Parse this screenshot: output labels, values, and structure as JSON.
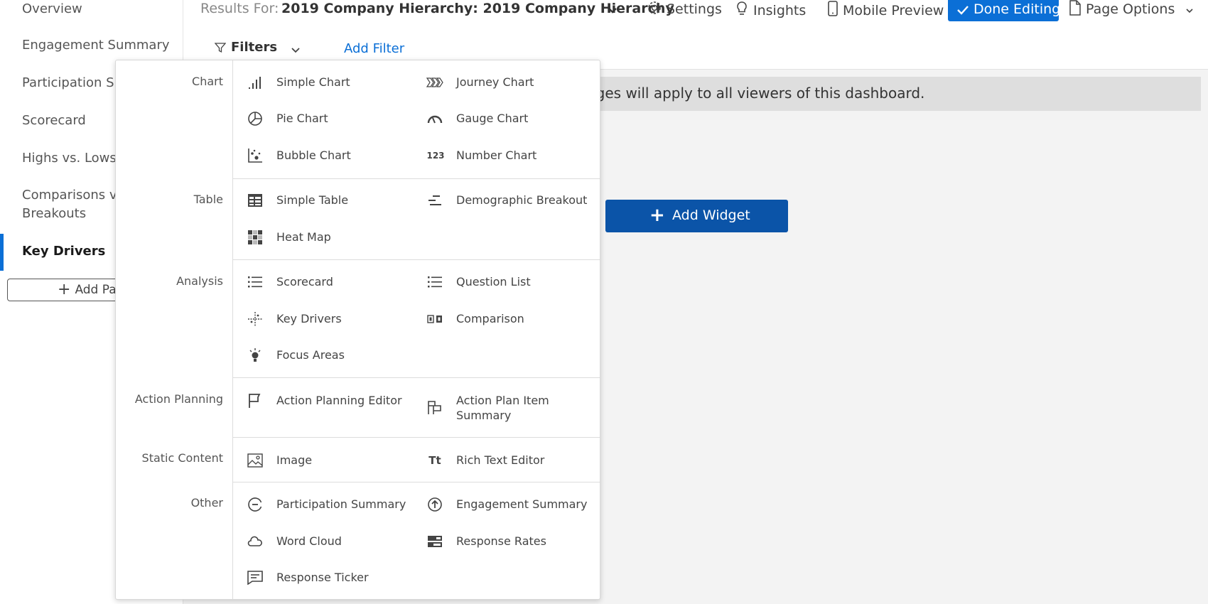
{
  "sidebar": {
    "items": [
      {
        "label": "Overview"
      },
      {
        "label": "Engagement Summary"
      },
      {
        "label": "Participation Su"
      },
      {
        "label": "Scorecard"
      },
      {
        "label": "Highs vs. Lows"
      },
      {
        "label": "Comparisons vs"
      },
      {
        "label": "Breakouts"
      },
      {
        "label": "Key Drivers"
      }
    ],
    "add_page_label": "Add Pa"
  },
  "topbar": {
    "results_label": "Results For:",
    "results_value": "2019 Company Hierarchy:  2019 Company Hierarchy",
    "settings": "Settings",
    "insights": "Insights",
    "mobile_preview": "Mobile Preview",
    "done_editing": "Done Editing",
    "page_options": "Page Options",
    "filters": "Filters",
    "add_filter": "Add Filter"
  },
  "notice": "nges will apply to all viewers of this dashboard.",
  "add_widget": "Add Widget",
  "colors": {
    "accent": "#0b6fd6",
    "add_widget": "#0b54a8"
  },
  "menu": {
    "categories": {
      "chart": "Chart",
      "table": "Table",
      "analysis": "Analysis",
      "action_planning": "Action Planning",
      "static_content": "Static Content",
      "other": "Other"
    },
    "items": {
      "simple_chart": "Simple Chart",
      "journey_chart": "Journey Chart",
      "pie_chart": "Pie Chart",
      "gauge_chart": "Gauge Chart",
      "bubble_chart": "Bubble Chart",
      "number_chart": "Number Chart",
      "number_chart_icon": "123",
      "simple_table": "Simple Table",
      "demographic_breakout": "Demographic Breakout",
      "heat_map": "Heat Map",
      "scorecard": "Scorecard",
      "question_list": "Question List",
      "key_drivers": "Key Drivers",
      "comparison": "Comparison",
      "focus_areas": "Focus Areas",
      "action_planning_editor": "Action Planning Editor",
      "action_plan_item_summary_1": "Action Plan Item",
      "action_plan_item_summary_2": "Summary",
      "image": "Image",
      "rich_text_editor": "Rich Text Editor",
      "rich_text_icon": "Tt",
      "participation_summary": "Participation Summary",
      "engagement_summary": "Engagement Summary",
      "word_cloud": "Word Cloud",
      "response_rates": "Response Rates",
      "response_ticker": "Response Ticker"
    }
  }
}
